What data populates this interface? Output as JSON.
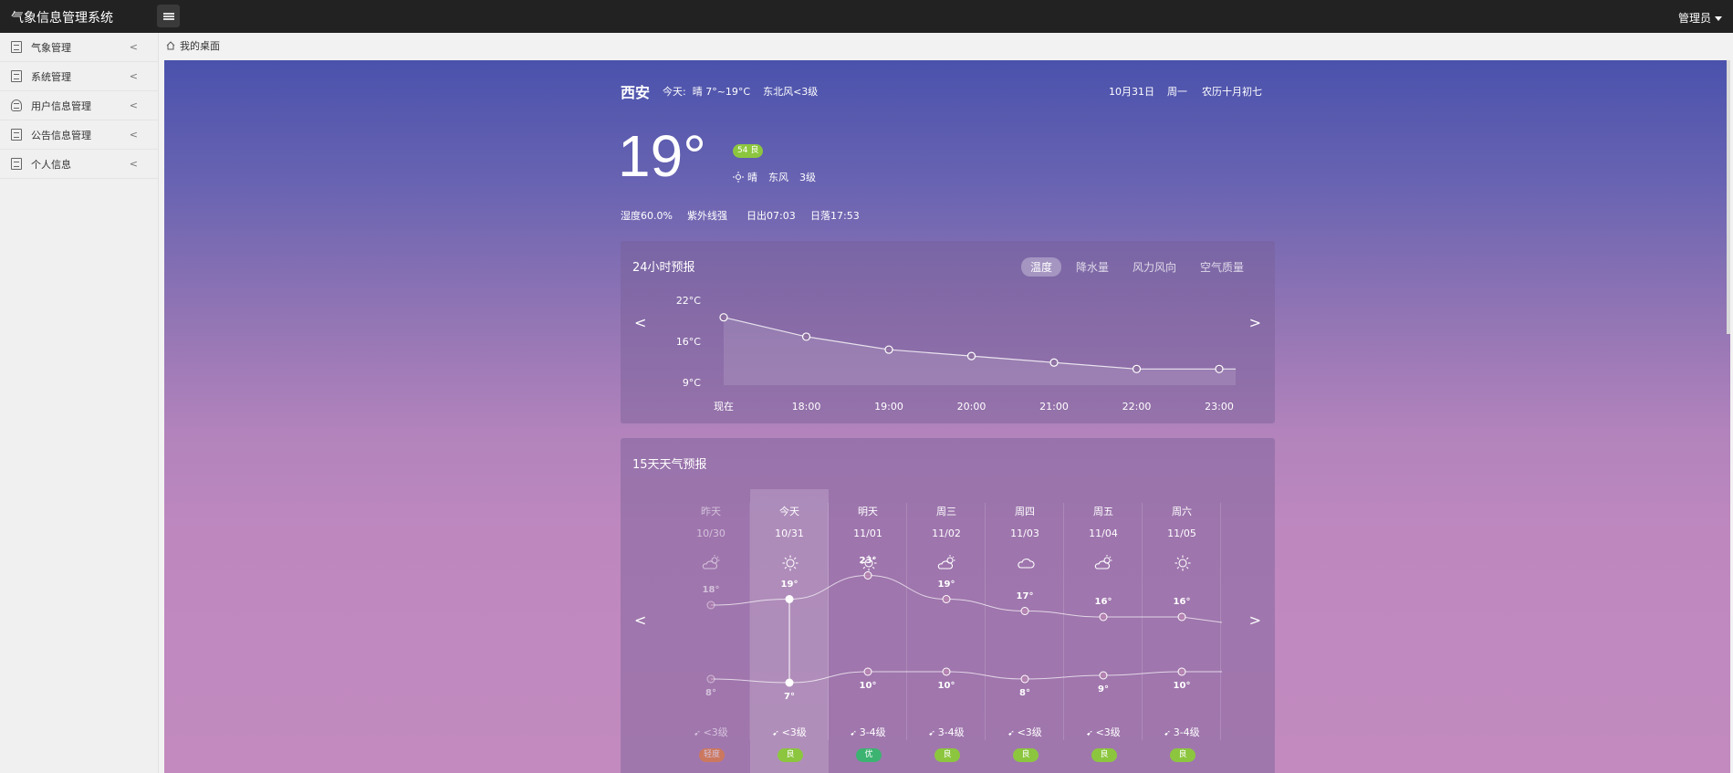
{
  "app": {
    "title": "气象信息管理系统",
    "user": "管理员"
  },
  "sidebar": {
    "items": [
      {
        "label": "气象管理",
        "icon": "doc-icon"
      },
      {
        "label": "系统管理",
        "icon": "doc-icon"
      },
      {
        "label": "用户信息管理",
        "icon": "user-icon"
      },
      {
        "label": "公告信息管理",
        "icon": "doc-icon"
      },
      {
        "label": "个人信息",
        "icon": "doc-icon"
      }
    ]
  },
  "breadcrumb": {
    "label": "我的桌面"
  },
  "weather": {
    "city": "西安",
    "today_summary": "今天:  晴 7°~19°C    东北风<3级",
    "date": "10月31日",
    "weekday": "周一",
    "lunar": "农历十月初七",
    "current_temp": "19°",
    "aqi": "54 良",
    "condition": "晴",
    "wind_dir": "东风",
    "wind_level": "3级",
    "humidity": "湿度60.0%",
    "uv": "紫外线强",
    "sunrise": "日出07:03",
    "sunset": "日落17:53"
  },
  "hourly": {
    "title": "24小时预报",
    "tabs": [
      "温度",
      "降水量",
      "风力风向",
      "空气质量"
    ],
    "active_tab": "温度"
  },
  "chart_data": {
    "type": "area",
    "title": "24小时预报",
    "x": [
      "现在",
      "18:00",
      "19:00",
      "20:00",
      "21:00",
      "22:00",
      "23:00"
    ],
    "y_ticks": [
      "22°C",
      "16°C",
      "9°C"
    ],
    "ylim": [
      9,
      22
    ],
    "series": [
      {
        "values": [
          19.5,
          16.5,
          14.5,
          13.5,
          12.5,
          11.5,
          11.5
        ]
      }
    ]
  },
  "daily": {
    "title": "15天天气预报",
    "days": [
      {
        "day": "昨天",
        "date": "10/30",
        "icon": "partly-cloudy-icon",
        "hi": "18°",
        "lo": "8°",
        "hi_val": 18,
        "lo_val": 8,
        "wind": "<3级",
        "aqi": "轻度",
        "aqi_color": "#f07a1e"
      },
      {
        "day": "今天",
        "date": "10/31",
        "icon": "sun-icon",
        "hi": "19°",
        "lo": "7°",
        "hi_val": 19,
        "lo_val": 7,
        "wind": "<3级",
        "aqi": "良",
        "aqi_color": "#8cc63f"
      },
      {
        "day": "明天",
        "date": "11/01",
        "icon": "sun-icon",
        "hi": "23°",
        "lo": "10°",
        "hi_val": 23,
        "lo_val": 10,
        "wind": "3-4级",
        "aqi": "优",
        "aqi_color": "#3cb371"
      },
      {
        "day": "周三",
        "date": "11/02",
        "icon": "partly-cloudy-icon",
        "hi": "19°",
        "lo": "10°",
        "hi_val": 19,
        "lo_val": 10,
        "wind": "3-4级",
        "aqi": "良",
        "aqi_color": "#8cc63f"
      },
      {
        "day": "周四",
        "date": "11/03",
        "icon": "cloud-icon",
        "hi": "17°",
        "lo": "8°",
        "hi_val": 17,
        "lo_val": 8,
        "wind": "<3级",
        "aqi": "良",
        "aqi_color": "#8cc63f"
      },
      {
        "day": "周五",
        "date": "11/04",
        "icon": "partly-cloudy-icon",
        "hi": "16°",
        "lo": "9°",
        "hi_val": 16,
        "lo_val": 9,
        "wind": "<3级",
        "aqi": "良",
        "aqi_color": "#8cc63f"
      },
      {
        "day": "周六",
        "date": "11/05",
        "icon": "sun-icon",
        "hi": "16°",
        "lo": "10°",
        "hi_val": 16,
        "lo_val": 10,
        "wind": "3-4级",
        "aqi": "良",
        "aqi_color": "#8cc63f"
      }
    ]
  }
}
